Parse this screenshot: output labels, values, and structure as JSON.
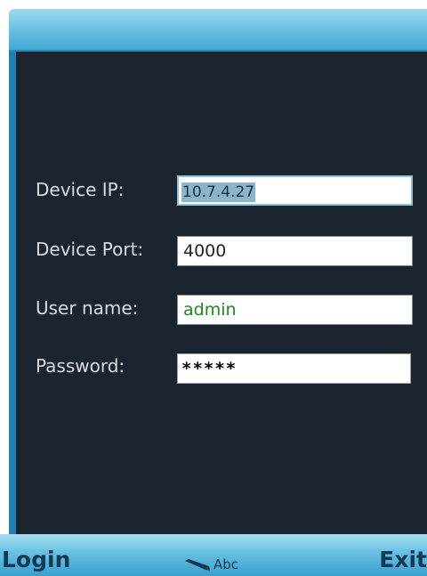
{
  "form": {
    "device_ip": {
      "label": "Device IP:",
      "value": "10.7.4.27"
    },
    "device_port": {
      "label": "Device Port:",
      "value": "4000"
    },
    "user_name": {
      "label": "User name:",
      "value": "admin"
    },
    "password": {
      "label": "Password:",
      "value": "*****"
    }
  },
  "softkeys": {
    "left": "Login",
    "right": "Exit",
    "input_mode": "Abc",
    "input_mode_icon": "pencil-icon"
  },
  "colors": {
    "background": "#1a2530",
    "bar_accent": "#6cc2e3",
    "username_text": "#1d8a1d"
  }
}
